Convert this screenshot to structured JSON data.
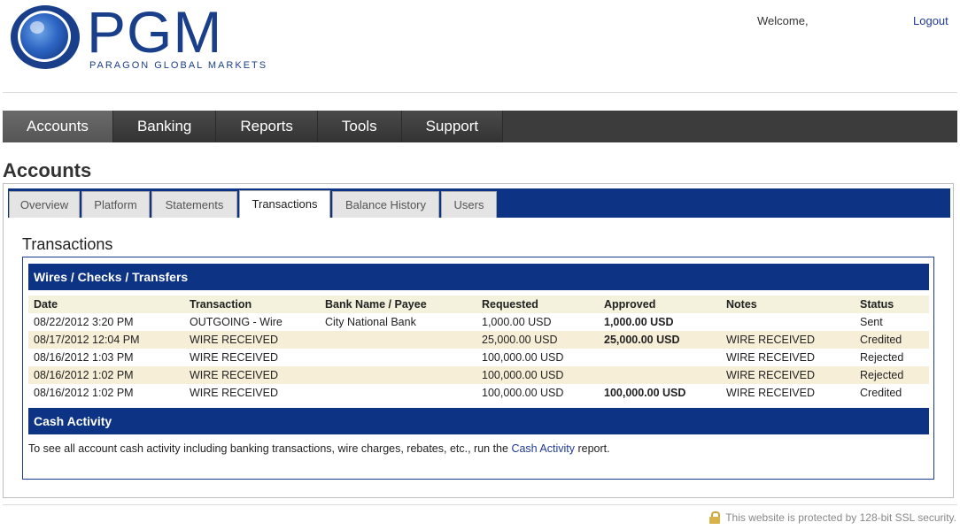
{
  "header": {
    "logo_text": "PGM",
    "logo_subtitle": "PARAGON GLOBAL MARKETS",
    "welcome": "Welcome,",
    "logout": "Logout"
  },
  "main_nav": {
    "items": [
      "Accounts",
      "Banking",
      "Reports",
      "Tools",
      "Support"
    ],
    "active": "Accounts"
  },
  "page_title": "Accounts",
  "tabs": {
    "items": [
      "Overview",
      "Platform",
      "Statements",
      "Transactions",
      "Balance History",
      "Users"
    ],
    "active": "Transactions"
  },
  "section_title": "Transactions",
  "wires": {
    "title": "Wires / Checks / Transfers",
    "columns": [
      "Date",
      "Transaction",
      "Bank Name / Payee",
      "Requested",
      "Approved",
      "Notes",
      "Status"
    ],
    "rows": [
      [
        "08/22/2012 3:20 PM",
        "OUTGOING - Wire",
        "City National Bank",
        "1,000.00 USD",
        "1,000.00 USD",
        "",
        "Sent"
      ],
      [
        "08/17/2012 12:04 PM",
        "WIRE RECEIVED",
        "",
        "25,000.00 USD",
        "25,000.00 USD",
        "WIRE RECEIVED",
        "Credited"
      ],
      [
        "08/16/2012 1:03 PM",
        "WIRE RECEIVED",
        "",
        "100,000.00 USD",
        "",
        "WIRE RECEIVED",
        "Rejected"
      ],
      [
        "08/16/2012 1:02 PM",
        "WIRE RECEIVED",
        "",
        "100,000.00 USD",
        "",
        "WIRE RECEIVED",
        "Rejected"
      ],
      [
        "08/16/2012 1:02 PM",
        "WIRE RECEIVED",
        "",
        "100,000.00 USD",
        "100,000.00 USD",
        "WIRE RECEIVED",
        "Credited"
      ]
    ]
  },
  "cash": {
    "title": "Cash Activity",
    "text_before": "To see all account cash activity including banking transactions, wire charges, rebates, etc., run the ",
    "link": "Cash Activity",
    "text_after": " report."
  },
  "footer": {
    "ssl_text": "This website is protected by 128-bit SSL security.",
    "ssl_icon": "lock-icon"
  },
  "colors": {
    "brand_blue": "#0d3384",
    "nav_dark": "#3c3c3c",
    "row_alt": "#f7eed8"
  }
}
